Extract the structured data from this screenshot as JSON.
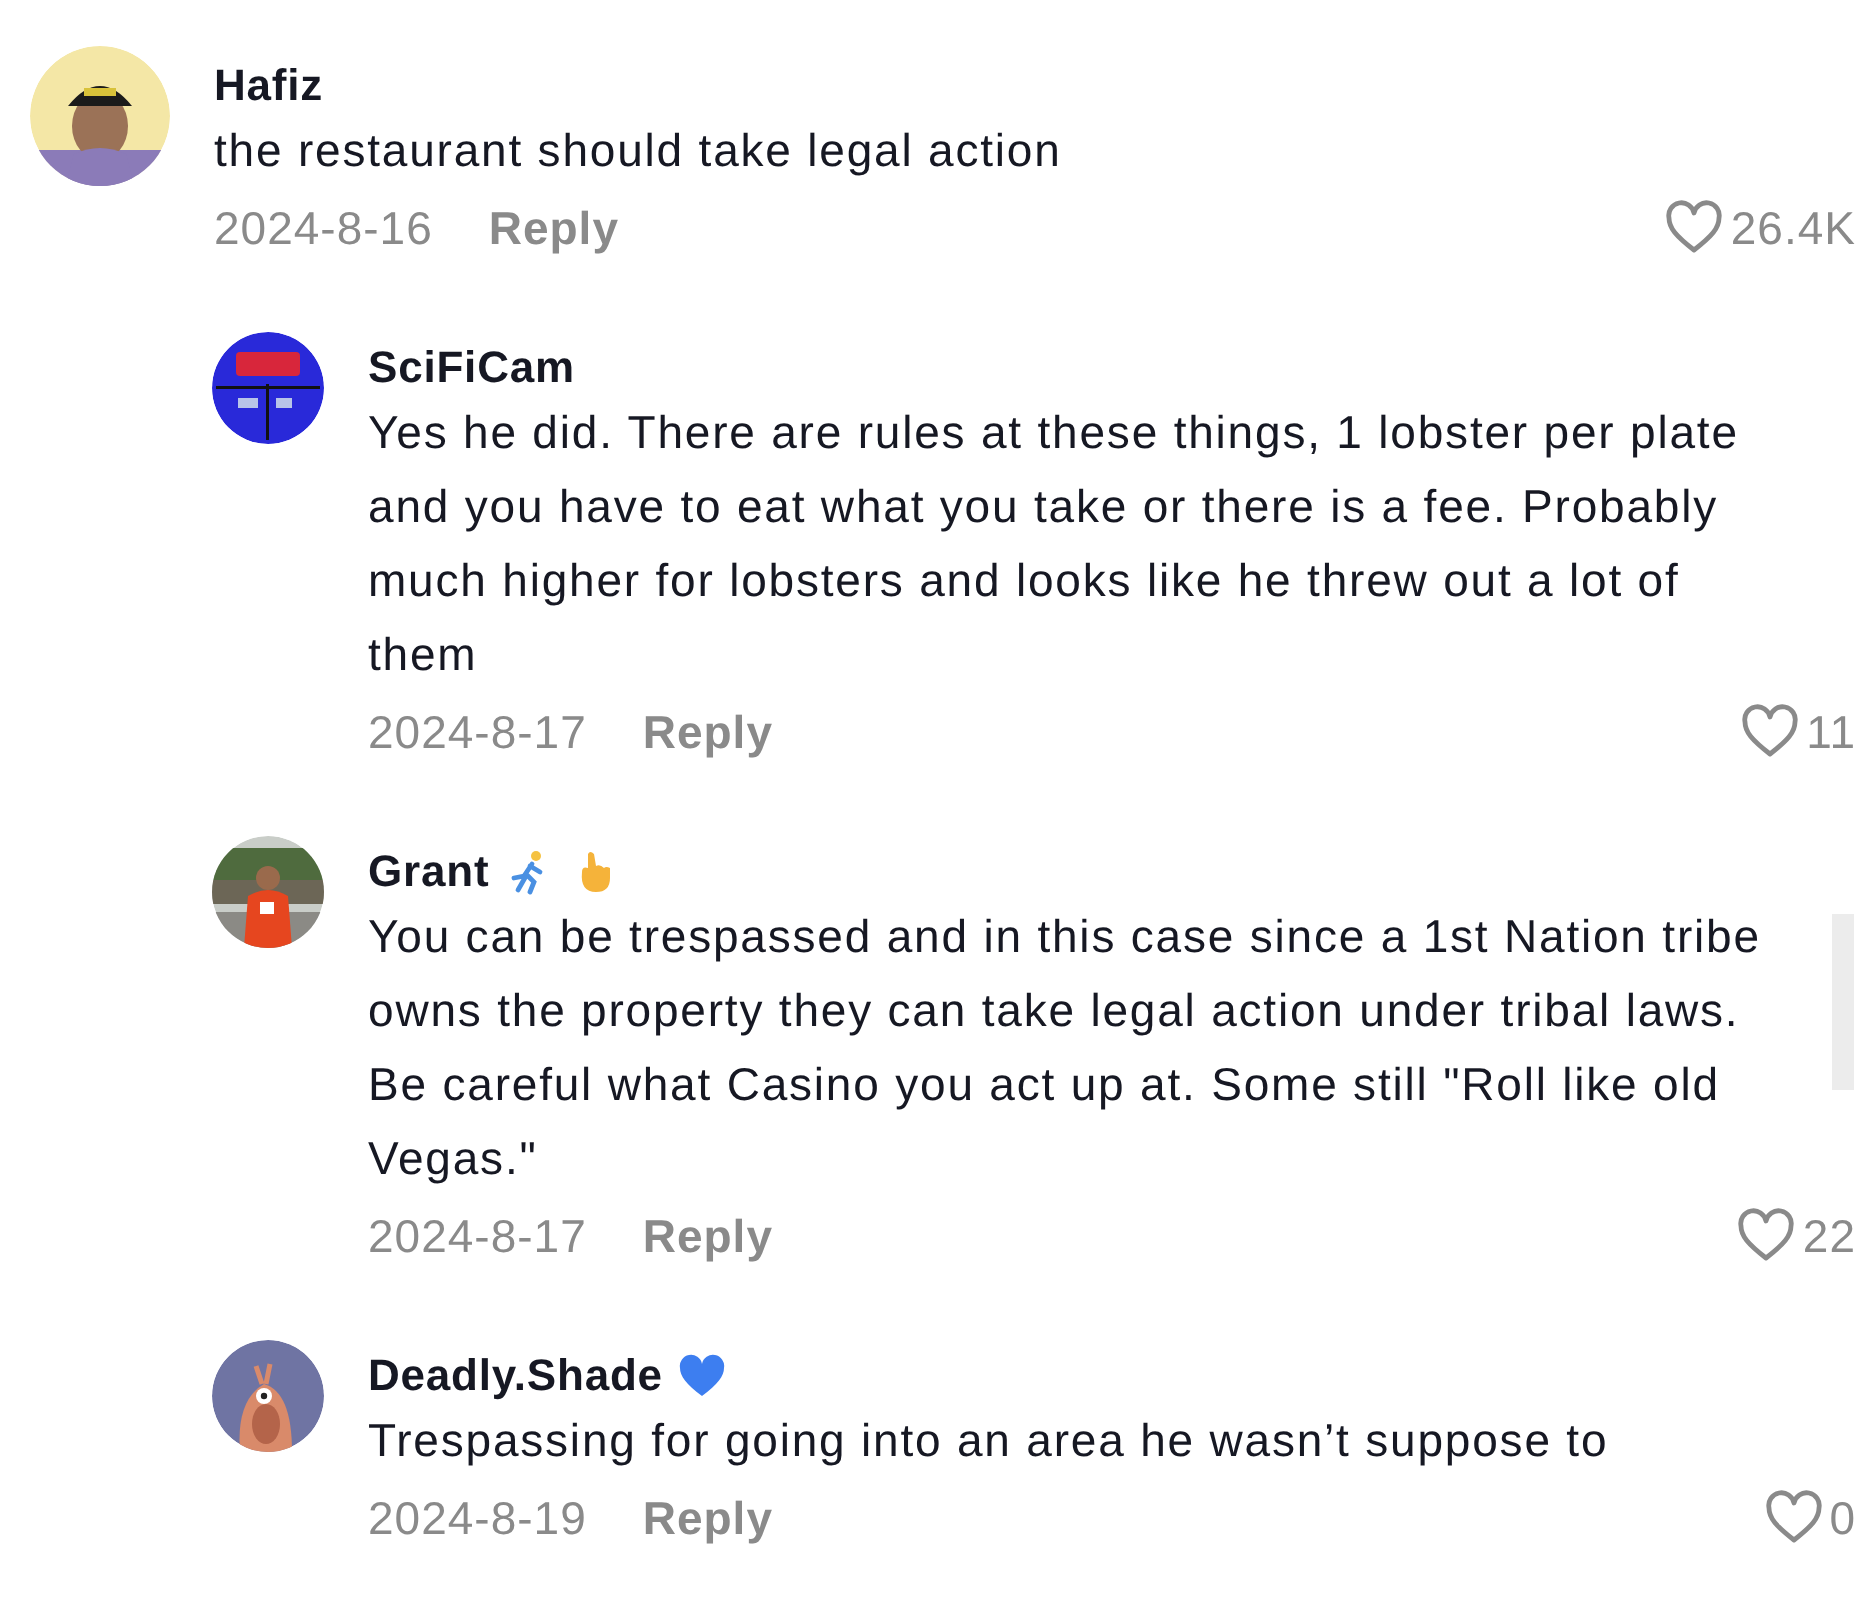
{
  "comments": [
    {
      "author": "Hafiz",
      "avatar": {
        "kind": "picture"
      },
      "text": "the restaurant should take legal action",
      "date": "2024-8-16",
      "reply_label": "Reply",
      "likes": "26.4K",
      "replies": [
        {
          "author": "SciFiCam",
          "avatar": {
            "kind": "picture"
          },
          "text": "Yes he did. There are rules at these things, 1 lobster per plate and you have to eat what you take or there is a fee. Probably much higher for lobsters and looks like he threw out a lot of them",
          "date": "2024-8-17",
          "reply_label": "Reply",
          "likes": "11"
        },
        {
          "author": "Grant",
          "emojis": [
            {
              "kind": "runner"
            },
            {
              "kind": "hand"
            }
          ],
          "avatar": {
            "kind": "picture"
          },
          "text": "You can be trespassed and in this case since a 1st Nation tribe owns the property they can take legal action under tribal laws. Be careful what Casino you act up at. Some still \"Roll like old Vegas.\"",
          "date": "2024-8-17",
          "reply_label": "Reply",
          "likes": "22"
        },
        {
          "author": "Deadly.Shade",
          "emojis": [
            {
              "kind": "heart"
            }
          ],
          "avatar": {
            "kind": "picture"
          },
          "text": "Trespassing for going into an area he wasn’t suppose to",
          "date": "2024-8-19",
          "reply_label": "Reply",
          "likes": "0"
        }
      ]
    }
  ]
}
